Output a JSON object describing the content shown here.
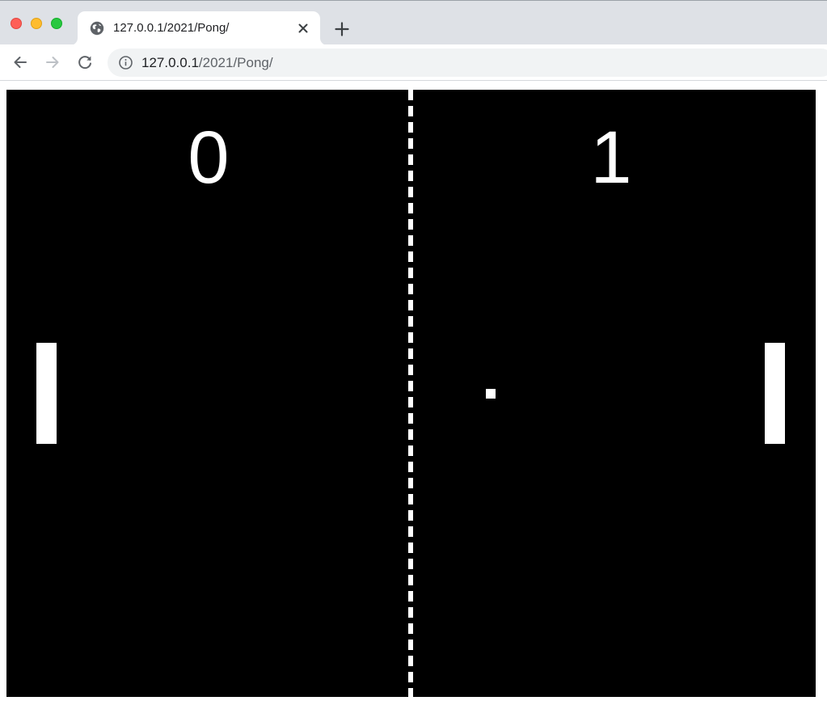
{
  "browser": {
    "tab": {
      "title": "127.0.0.1/2021/Pong/",
      "favicon": "globe-icon"
    },
    "new_tab_icon": "plus-icon",
    "address_bar": {
      "host": "127.0.0.1",
      "path": "/2021/Pong/",
      "security_icon": "info-icon"
    },
    "nav": {
      "back_icon": "arrow-left-icon",
      "forward_icon": "arrow-right-icon",
      "reload_icon": "reload-icon"
    },
    "window_controls": [
      "close",
      "minimize",
      "maximize"
    ]
  },
  "game": {
    "title": "Pong",
    "score": {
      "left": "0",
      "right": "1"
    },
    "colors": {
      "background": "#000000",
      "foreground": "#ffffff"
    }
  }
}
